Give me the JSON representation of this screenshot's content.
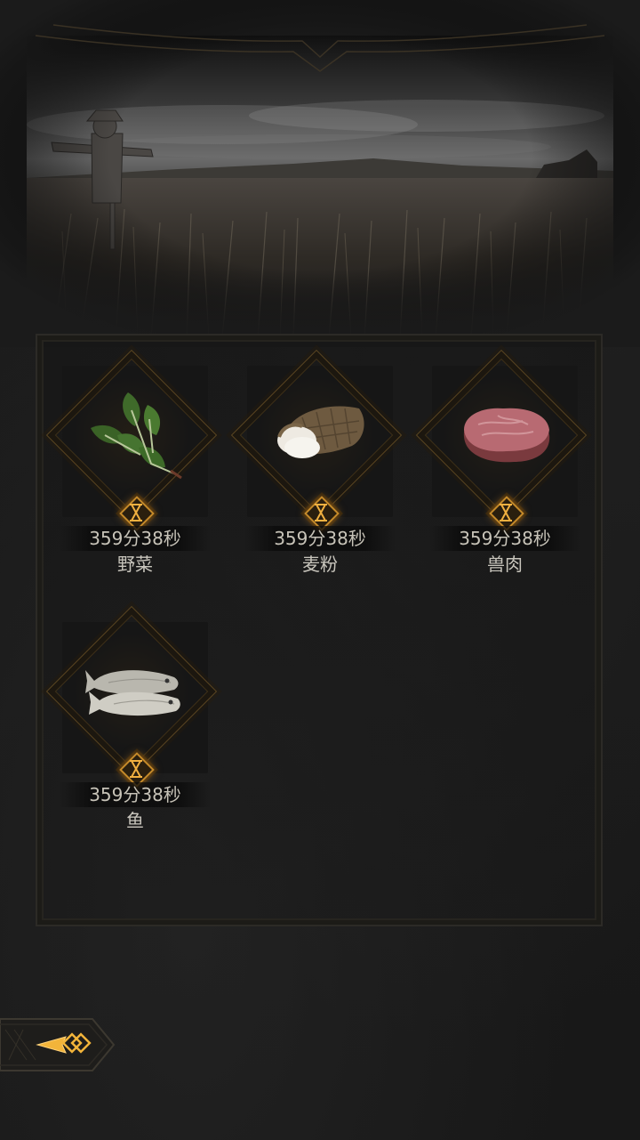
{
  "items": [
    {
      "name": "野菜",
      "time": "359分38秒",
      "icon": "wild-vegetable-icon"
    },
    {
      "name": "麦粉",
      "time": "359分38秒",
      "icon": "flour-sack-icon"
    },
    {
      "name": "兽肉",
      "time": "359分38秒",
      "icon": "meat-icon"
    },
    {
      "name": "鱼",
      "time": "359分38秒",
      "icon": "fish-icon"
    }
  ],
  "timer_icon": "hourglass-icon",
  "back_icon": "back-arrow-icon",
  "colors": {
    "accent_gold": "#c58a2a",
    "text": "#c7c3b8",
    "background": "#1b1b1b"
  }
}
